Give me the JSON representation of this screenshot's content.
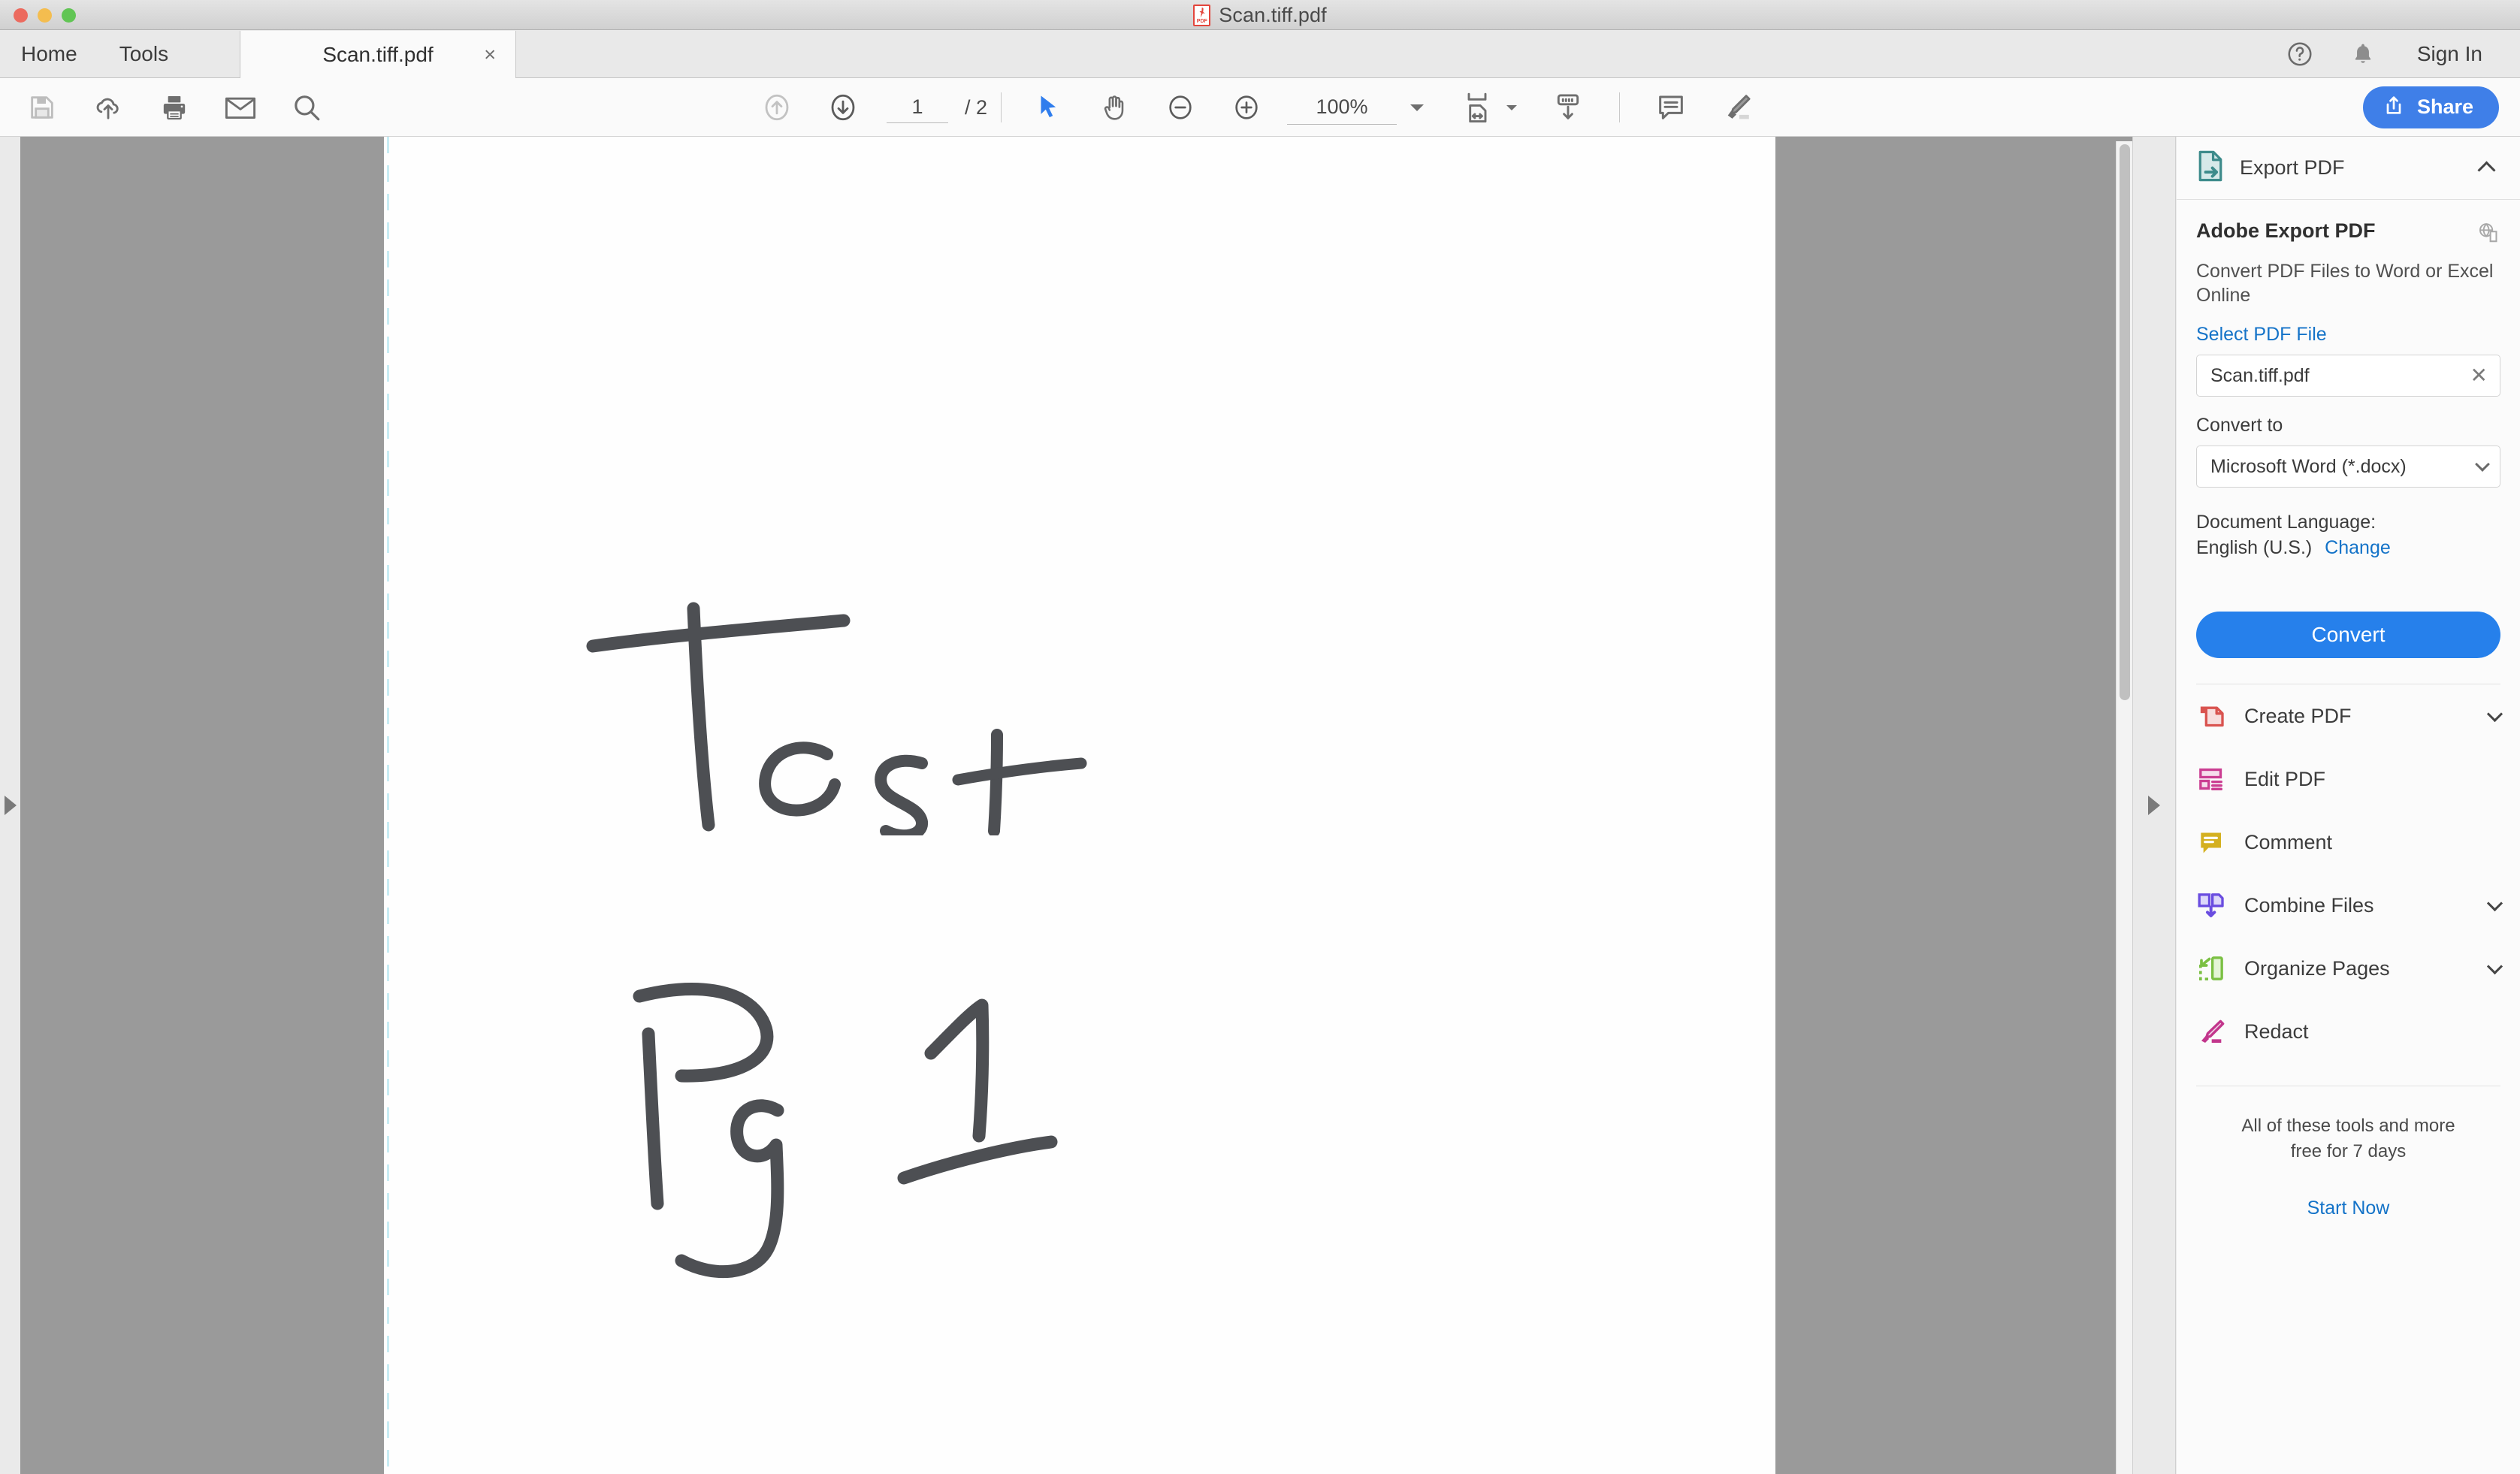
{
  "window": {
    "title": "Scan.tiff.pdf",
    "title_icon": "pdf-file-icon",
    "traffic_lights": [
      "close-button",
      "minimize-button",
      "maximize-button"
    ]
  },
  "menubar": {
    "items": [
      {
        "label": "Home",
        "name": "menu-item-home"
      },
      {
        "label": "Tools",
        "name": "menu-item-tools"
      }
    ],
    "tab": {
      "label": "Scan.tiff.pdf",
      "close_glyph": "×"
    },
    "right": {
      "help_icon": "help-circle-icon",
      "bell_icon": "notification-bell-icon",
      "sign_in_label": "Sign In"
    }
  },
  "toolbar": {
    "left_tools": [
      {
        "name": "save-file-icon",
        "label": "Save"
      },
      {
        "name": "upload-cloud-icon",
        "label": "Save to cloud"
      },
      {
        "name": "print-icon",
        "label": "Print"
      },
      {
        "name": "email-icon",
        "label": "Email"
      },
      {
        "name": "search-icon",
        "label": "Search"
      }
    ],
    "page_up_icon": "arrow-up-circle-icon",
    "page_down_icon": "arrow-down-circle-icon",
    "page_current": "1",
    "page_total": "/ 2",
    "select_tool_icon": "cursor-arrow-icon",
    "hand_tool_icon": "hand-icon",
    "zoom_out_icon": "zoom-out-icon",
    "zoom_in_icon": "zoom-in-icon",
    "zoom_level": "100%",
    "fit_page_icon": "fit-page-icon",
    "scroll_mode_icon": "scroll-mode-icon",
    "comment_icon": "comment-bubble-icon",
    "highlight_icon": "highlighter-icon",
    "share": {
      "label": "Share",
      "icon": "share-upload-icon",
      "color": "#3f7fe8"
    }
  },
  "viewer": {
    "left_expand_icon": "expand-left-panel-icon",
    "right_expand_icon": "expand-right-panel-icon",
    "scrollbar": "vertical-scrollbar",
    "page_content": {
      "line1": "Test",
      "line2": "Pg 1",
      "description": "handwritten marker text on scanned white page"
    },
    "background_color": "#9a9a9a",
    "page_color": "#fefefe"
  },
  "right_panel": {
    "export": {
      "header_label": "Export PDF",
      "header_icon": "export-pdf-icon",
      "collapse_icon": "chevron-up-icon",
      "heading": "Adobe Export PDF",
      "heading_icon": "globe-copy-icon",
      "description": "Convert PDF Files to Word or Excel Online",
      "select_file_link": "Select PDF File",
      "file_value": "Scan.tiff.pdf",
      "file_clear_glyph": "✕",
      "convert_to_label": "Convert to",
      "convert_to_value": "Microsoft Word (*.docx)",
      "convert_to_options": [
        "Microsoft Word (*.docx)"
      ],
      "document_language_label": "Document Language:",
      "document_language_value": "English (U.S.)",
      "change_link": "Change",
      "convert_button": "Convert",
      "convert_button_color": "#2680eb"
    },
    "tools": [
      {
        "label": "Create PDF",
        "icon": "create-pdf-icon",
        "color": "#d9534f",
        "has_chevron": true
      },
      {
        "label": "Edit PDF",
        "icon": "edit-pdf-icon",
        "color": "#cb3e92",
        "has_chevron": false
      },
      {
        "label": "Comment",
        "icon": "comment-icon",
        "color": "#d4b020",
        "has_chevron": false
      },
      {
        "label": "Combine Files",
        "icon": "combine-files-icon",
        "color": "#6a4de0",
        "has_chevron": true
      },
      {
        "label": "Organize Pages",
        "icon": "organize-pages-icon",
        "color": "#7bc043",
        "has_chevron": true
      },
      {
        "label": "Redact",
        "icon": "redact-icon",
        "color": "#c2368c",
        "has_chevron": false
      }
    ],
    "promo": {
      "line1": "All of these tools and more",
      "line2": "free for 7 days",
      "cta": "Start Now"
    }
  }
}
